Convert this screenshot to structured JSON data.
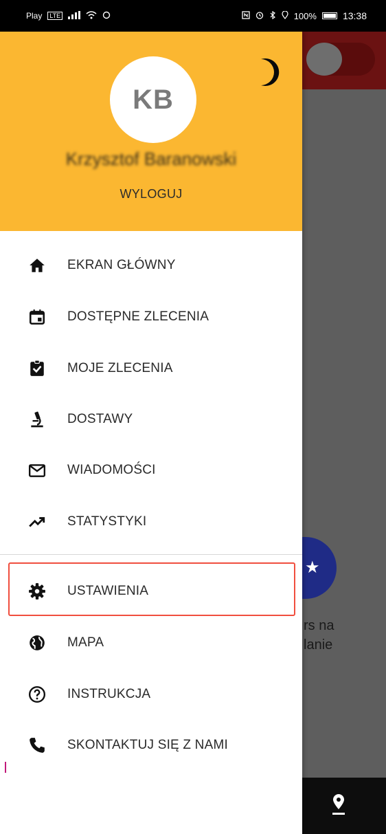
{
  "status_bar": {
    "carrier": "Play",
    "carrier_badge": "LTE",
    "battery": "100%",
    "time": "13:38"
  },
  "drawer": {
    "avatar_initials": "KB",
    "user_name": "Krzysztof Baranowski",
    "logout_label": "WYLOGUJ",
    "theme_toggle_icon": "moon-icon",
    "header_color": "#fbb731",
    "menu": [
      {
        "label": "EKRAN GŁÓWNY",
        "icon": "home-icon"
      },
      {
        "label": "DOSTĘPNE ZLECENIA",
        "icon": "calendar-icon"
      },
      {
        "label": "MOJE ZLECENIA",
        "icon": "clipboard-check-icon"
      },
      {
        "label": "DOSTAWY",
        "icon": "microscope-icon"
      },
      {
        "label": "WIADOMOŚCI",
        "icon": "mail-icon"
      },
      {
        "label": "STATYSTYKI",
        "icon": "trending-up-icon"
      },
      {
        "label": "USTAWIENIA",
        "icon": "gear-icon"
      },
      {
        "label": "MAPA",
        "icon": "globe-icon"
      },
      {
        "label": "INSTRUKCJA",
        "icon": "help-circle-icon"
      },
      {
        "label": "SKONTAKTUJ SIĘ Z NAMI",
        "icon": "phone-icon"
      }
    ],
    "highlight_color": "#f04e3e"
  },
  "background_app": {
    "partial_text_line1": "rs na",
    "partial_text_line2": "lanie",
    "header_color": "#6b1212",
    "badge_color": "#1f2b86"
  }
}
